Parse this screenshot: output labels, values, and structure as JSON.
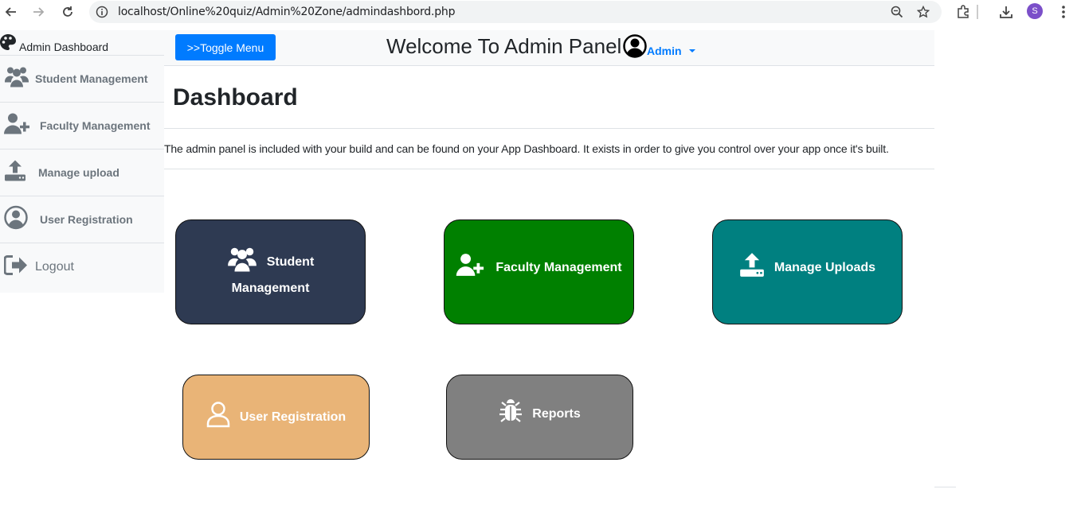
{
  "browser": {
    "url": "localhost/Online%20quiz/Admin%20Zone/admindashbord.php",
    "profile_initial": "S"
  },
  "sidebar": {
    "brand": "Admin Dashboard",
    "items": [
      {
        "label": "Student Management",
        "icon": "users-icon"
      },
      {
        "label": "Faculty Management",
        "icon": "user-plus-icon"
      },
      {
        "label": "Manage upload",
        "icon": "upload-icon"
      },
      {
        "label": "User Registration",
        "icon": "user-circle-icon"
      },
      {
        "label": "Logout",
        "icon": "sign-out-icon"
      }
    ]
  },
  "header": {
    "toggle_label": ">>Toggle Menu",
    "welcome": "Welcome To Admin Panel",
    "user": "Admin"
  },
  "main": {
    "title": "Dashboard",
    "description": "The admin panel is included with your build and can be found on your App Dashboard. It exists in order to give you control over your app once it's built."
  },
  "cards": [
    {
      "label_line1": "Student",
      "label_line2": "Management",
      "color": "#2e3a52",
      "icon": "users-icon"
    },
    {
      "label": "Faculty Management",
      "color": "#008000",
      "icon": "user-plus-icon"
    },
    {
      "label": "Manage Uploads",
      "color": "#008080",
      "icon": "upload-icon"
    },
    {
      "label": "User Registration",
      "color": "#e9b477",
      "icon": "user-outline-icon"
    },
    {
      "label": "Reports",
      "color": "#808080",
      "icon": "bug-icon"
    }
  ]
}
